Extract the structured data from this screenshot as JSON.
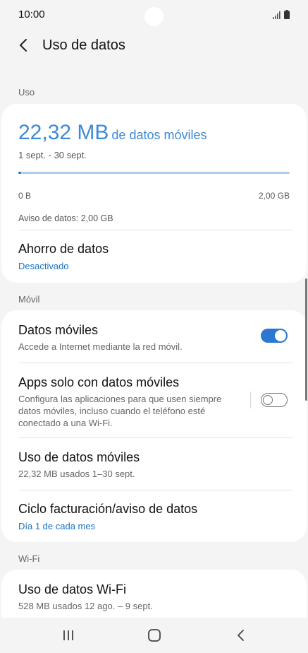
{
  "status_bar": {
    "time": "10:00",
    "icons": [
      "signal-icon",
      "battery-icon"
    ]
  },
  "header": {
    "back_icon": "back-arrow-icon",
    "title": "Uso de datos"
  },
  "sections": {
    "uso": "Uso",
    "movil": "Móvil",
    "wifi": "Wi-Fi"
  },
  "usage": {
    "amount": "22,32 MB",
    "amount_suffix": "de datos móviles",
    "period": "1 sept. - 30 sept.",
    "progress_fraction": 0.011,
    "min_label": "0 B",
    "max_label": "2,00 GB",
    "warning": "Aviso de datos: 2,00 GB"
  },
  "ahorro": {
    "title": "Ahorro de datos",
    "status": "Desactivado"
  },
  "datos_moviles": {
    "title": "Datos móviles",
    "subtitle": "Accede a Internet mediante la red móvil.",
    "enabled": true
  },
  "apps_solo": {
    "title": "Apps solo con datos móviles",
    "subtitle_line1": "Configura las aplicaciones para que usen siempre",
    "subtitle_line2": "datos móviles, incluso cuando el teléfono esté",
    "subtitle_line3": "conectado a una Wi-Fi.",
    "enabled": false
  },
  "uso_datos_moviles": {
    "title": "Uso de datos móviles",
    "subtitle": "22,32 MB usados 1–30 sept."
  },
  "ciclo": {
    "title": "Ciclo facturación/aviso de datos",
    "subtitle": "Día 1 de cada mes"
  },
  "wifi_usage": {
    "title": "Uso de datos Wi-Fi",
    "subtitle": "528 MB usados 12 ago. – 9 sept."
  },
  "colors": {
    "accent": "#3e8ad6",
    "accent_text": "#1a73c8",
    "toggle_on": "#2c78d0",
    "background": "#f4f4f4",
    "card": "#ffffff"
  },
  "nav_bar": {
    "icons": [
      "recent-apps-icon",
      "home-icon",
      "back-icon"
    ]
  }
}
